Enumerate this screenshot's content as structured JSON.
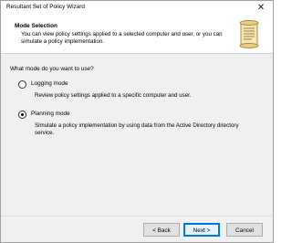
{
  "window": {
    "title": "Resultant Set of Policy Wizard",
    "close_glyph": "✕"
  },
  "header": {
    "title": "Mode Selection",
    "description": "You can view policy settings applied to a selected computer and user, or you can simulate a policy implementation.",
    "icon": "wizard-scroll-icon"
  },
  "body": {
    "question": "What mode do you want to use?",
    "options": [
      {
        "label": "Logging mode",
        "description": "Review policy settings applied to a specific computer and user.",
        "selected": false
      },
      {
        "label": "Planning mode",
        "description": "Simulate a policy implementation by using data from the Active Directory directory service.",
        "selected": true
      }
    ]
  },
  "footer": {
    "back_label": "< Back",
    "next_label": "Next >",
    "cancel_label": "Cancel"
  },
  "colors": {
    "accent": "#0078d7",
    "panel": "#f0f0f0",
    "scroll_paper": "#f6e7b4"
  }
}
